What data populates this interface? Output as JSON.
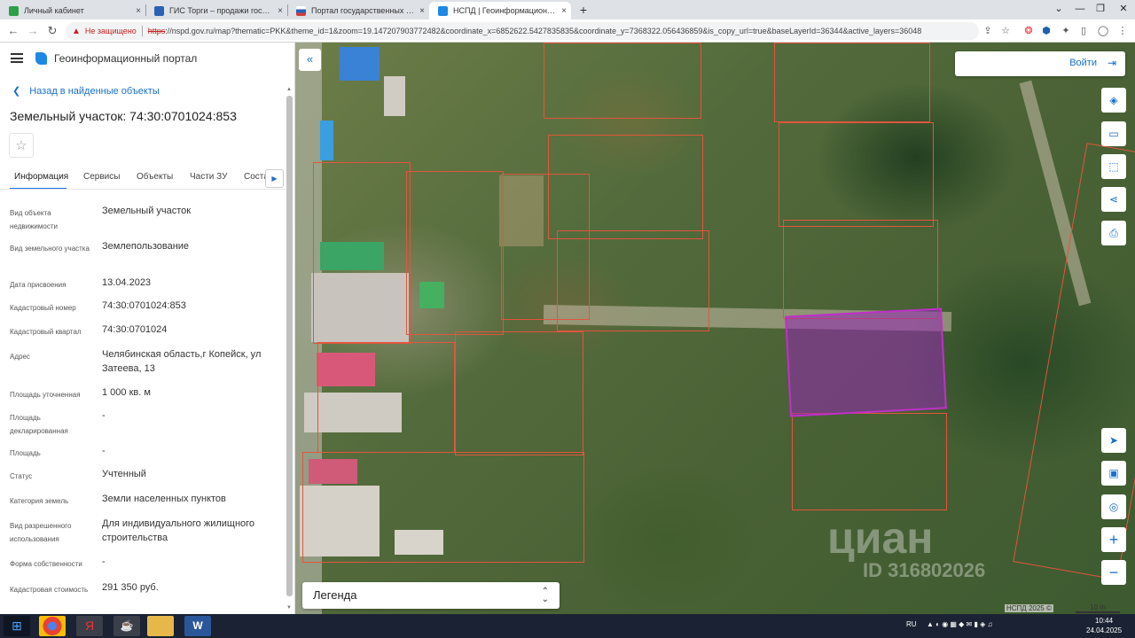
{
  "browser": {
    "tabs": [
      {
        "title": "Личный кабинет",
        "fav": "#2e9e4a"
      },
      {
        "title": "ГИС Торги – продажи государст",
        "fav": "#2a61b3"
      },
      {
        "title": "Портал государственных услуг",
        "fav": "#d23c3c"
      },
      {
        "title": "НСПД | Геоинформационный п",
        "fav": "#1e88e5",
        "active": true
      }
    ],
    "close_glyph": "×",
    "new_tab": "+",
    "not_secure": "Не защищено",
    "https": "https",
    "url": "://nspd.gov.ru/map?thematic=PKK&theme_id=1&zoom=19.147207903772482&coordinate_x=6852622.5427835835&coordinate_y=7368322.056436859&is_copy_url=true&baseLayerId=36344&active_layers=36048"
  },
  "panel": {
    "portal_title": "Геоинформационный портал",
    "back_link": "Назад в найденные объекты",
    "object_title": "Земельный участок: 74:30:0701024:853",
    "tabs": [
      "Информация",
      "Сервисы",
      "Объекты",
      "Части ЗУ",
      "Соста"
    ],
    "props": [
      {
        "label": "Вид объекта недвижимости",
        "value": "Земельный участок"
      },
      {
        "label": "Вид земельного участка",
        "value": "Землепользование"
      },
      {
        "label": "Дата присвоения",
        "value": "13.04.2023"
      },
      {
        "label": "Кадастровый номер",
        "value": "74:30:0701024:853"
      },
      {
        "label": "Кадастровый квартал",
        "value": "74:30:0701024"
      },
      {
        "label": "Адрес",
        "value": "Челябинская область,г Копейск, ул Затеева, 13"
      },
      {
        "label": "Площадь уточненная",
        "value": "1 000 кв. м"
      },
      {
        "label": "Площадь декларированная",
        "value": "-"
      },
      {
        "label": "Площадь",
        "value": "-"
      },
      {
        "label": "Статус",
        "value": "Учтенный"
      },
      {
        "label": "Категория земель",
        "value": "Земли населенных пунктов"
      },
      {
        "label": "Вид разрешенного использования",
        "value": "Для индивидуального жилищного строительства"
      },
      {
        "label": "Форма собственности",
        "value": "-"
      },
      {
        "label": "Кадастровая стоимость",
        "value": "291 350 руб."
      }
    ]
  },
  "map": {
    "login": "Войти",
    "legend": "Легенда",
    "watermark": "циан",
    "watermark_id": "ID 316802026",
    "copyright": "НСПД 2025 ©",
    "scale": "10 m",
    "zoom_in": "+",
    "zoom_out": "−"
  },
  "taskbar": {
    "lang": "RU",
    "time": "10:44",
    "date": "24.04.2025"
  }
}
